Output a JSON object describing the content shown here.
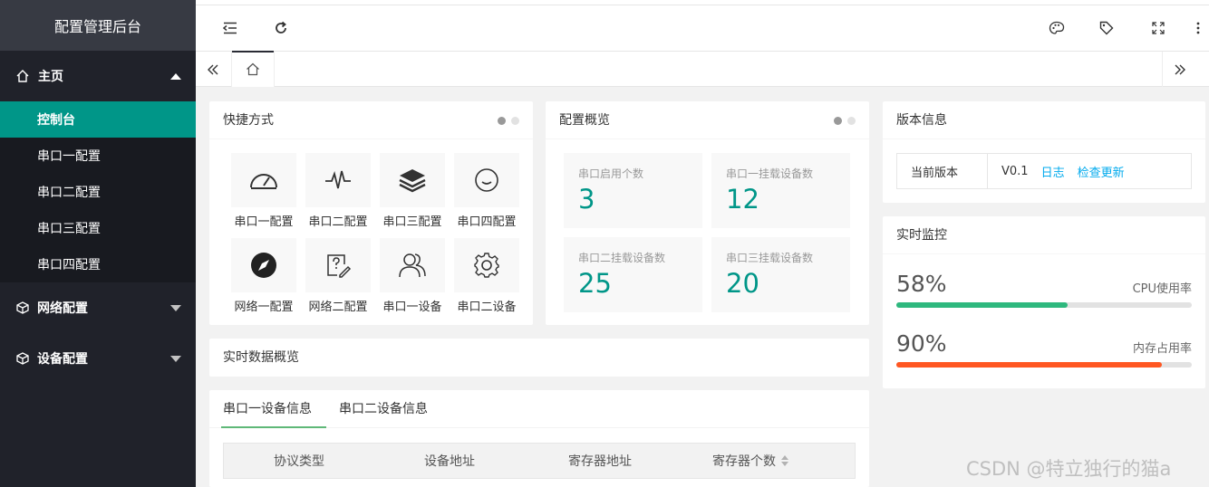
{
  "sidebar": {
    "logo": "配置管理后台",
    "home": "主页",
    "home_items": [
      "控制台",
      "串口一配置",
      "串口二配置",
      "串口三配置",
      "串口四配置"
    ],
    "groups": [
      "网络配置",
      "设备配置"
    ]
  },
  "shortcuts": {
    "title": "快捷方式",
    "items": [
      {
        "label": "串口一配置",
        "icon": "gauge-icon"
      },
      {
        "label": "串口二配置",
        "icon": "pulse-icon"
      },
      {
        "label": "串口三配置",
        "icon": "layers-icon"
      },
      {
        "label": "串口四配置",
        "icon": "smile-icon"
      },
      {
        "label": "网络一配置",
        "icon": "compass-icon"
      },
      {
        "label": "网络二配置",
        "icon": "edit-note-icon"
      },
      {
        "label": "串口一设备",
        "icon": "users-icon"
      },
      {
        "label": "串口二设备",
        "icon": "gear-icon"
      }
    ]
  },
  "overview": {
    "title": "配置概览",
    "stats": [
      {
        "label": "串口启用个数",
        "value": "3"
      },
      {
        "label": "串口一挂载设备数",
        "value": "12"
      },
      {
        "label": "串口二挂载设备数",
        "value": "25"
      },
      {
        "label": "串口三挂载设备数",
        "value": "20"
      }
    ]
  },
  "version": {
    "title": "版本信息",
    "key": "当前版本",
    "value": "V0.1",
    "log_link": "日志",
    "update_link": "检查更新"
  },
  "monitor": {
    "title": "实时监控",
    "cpu": {
      "value": "58%",
      "label": "CPU使用率",
      "fraction": 0.58,
      "color": "#2eb87e"
    },
    "mem": {
      "value": "90%",
      "label": "内存占用率",
      "fraction": 0.9,
      "color": "#ff5722"
    }
  },
  "realtime": {
    "title": "实时数据概览",
    "tabs": [
      "串口一设备信息",
      "串口二设备信息"
    ],
    "columns": [
      "协议类型",
      "设备地址",
      "寄存器地址",
      "寄存器个数"
    ]
  },
  "watermark": "CSDN @特立独行的猫a",
  "colors": {
    "accent": "#009688",
    "sidebar": "#20222a",
    "link": "#01aaed"
  }
}
